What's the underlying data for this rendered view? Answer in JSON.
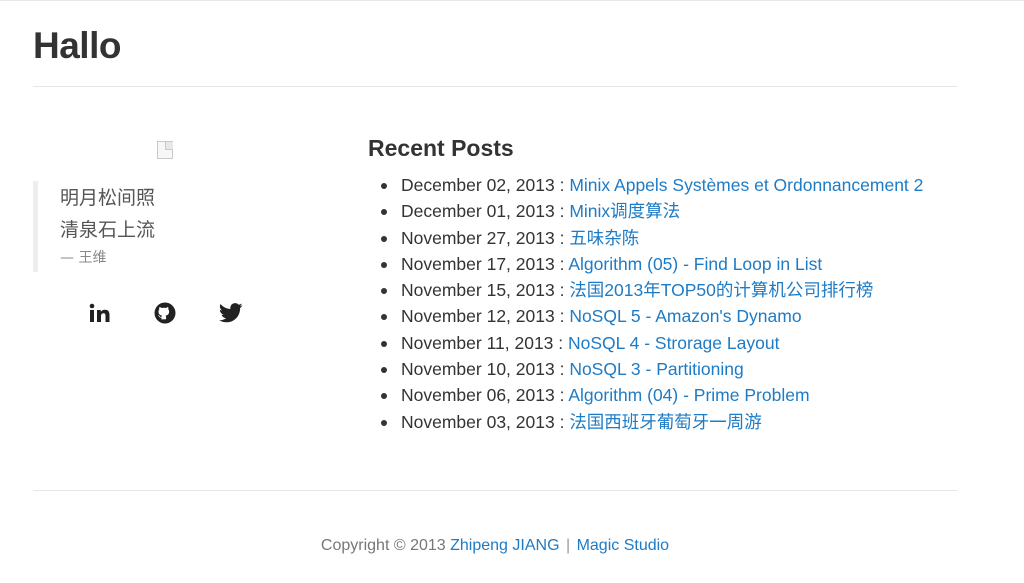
{
  "site": {
    "title": "Hallo"
  },
  "sidebar": {
    "avatar_icon": "broken-image-icon",
    "quote": {
      "line1": "明月松间照",
      "line2": "清泉石上流",
      "source": "— 王维"
    },
    "social": [
      {
        "name": "linkedin-icon"
      },
      {
        "name": "github-icon"
      },
      {
        "name": "twitter-icon"
      }
    ]
  },
  "recent_posts": {
    "title": "Recent Posts",
    "separator": " : ",
    "items": [
      {
        "date": "December 02, 2013",
        "title": "Minix Appels Systèmes et Ordonnancement 2"
      },
      {
        "date": "December 01, 2013",
        "title": "Minix调度算法"
      },
      {
        "date": "November 27, 2013",
        "title": "五味杂陈"
      },
      {
        "date": "November 17, 2013",
        "title": "Algorithm (05) - Find Loop in List"
      },
      {
        "date": "November 15, 2013",
        "title": "法国2013年TOP50的计算机公司排行榜"
      },
      {
        "date": "November 12, 2013",
        "title": "NoSQL 5 - Amazon's Dynamo"
      },
      {
        "date": "November 11, 2013",
        "title": "NoSQL 4 - Strorage Layout"
      },
      {
        "date": "November 10, 2013",
        "title": "NoSQL 3 - Partitioning"
      },
      {
        "date": "November 06, 2013",
        "title": "Algorithm (04) - Prime Problem"
      },
      {
        "date": "November 03, 2013",
        "title": "法国西班牙葡萄牙一周游"
      }
    ]
  },
  "footer": {
    "copyright": "Copyright © 2013",
    "author": "Zhipeng JIANG",
    "separator": "|",
    "studio": "Magic Studio"
  },
  "colors": {
    "link": "#1e7bc5",
    "text": "#333333",
    "muted": "#777777"
  }
}
